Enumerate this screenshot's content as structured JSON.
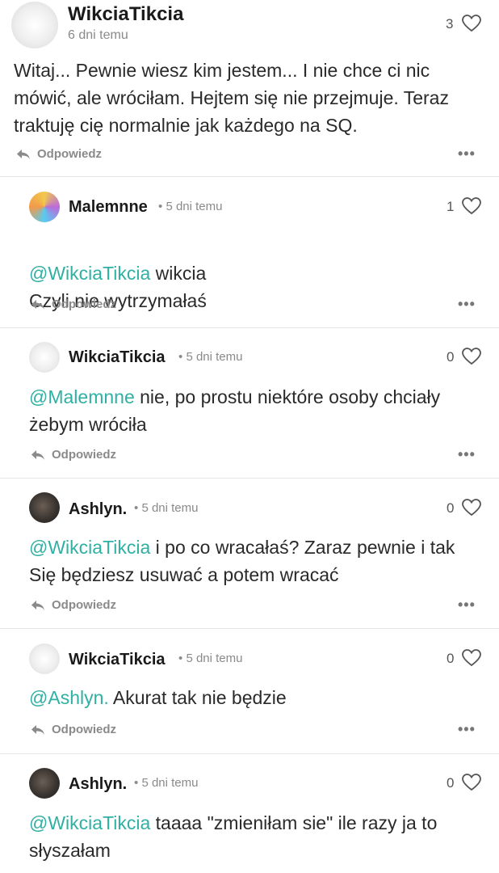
{
  "comments": [
    {
      "author": "WikciaTikcia",
      "time": "6 dni temu",
      "likes": "3",
      "mention": "",
      "text": "Witaj... Pewnie wiesz kim jestem... I nie chce ci nic mówić, ale wróciłam. Hejtem się nie przejmuje. Teraz traktuję cię normalnie jak każdego na SQ.",
      "reply": "Odpowiedz"
    },
    {
      "author": "Malemnne",
      "time": "5 dni temu",
      "likes": "1",
      "mention": "@WikciaTikcia",
      "text": " wikcia\nCzyli nie wytrzymałaś",
      "reply": "Odpowiedz"
    },
    {
      "author": "WikciaTikcia",
      "time": "5 dni temu",
      "likes": "0",
      "mention": "@Malemnne",
      "text": " nie, po prostu niektóre osoby chciały żebym wróciła",
      "reply": "Odpowiedz"
    },
    {
      "author": "Ashlyn.",
      "time": "5 dni temu",
      "likes": "0",
      "mention": "@WikciaTikcia",
      "text": " i po co wracałaś? Zaraz pewnie i tak Się będziesz usuwać a potem wracać",
      "reply": "Odpowiedz"
    },
    {
      "author": "WikciaTikcia",
      "time": "5 dni temu",
      "likes": "0",
      "mention": "@Ashlyn.",
      "text": " Akurat tak nie będzie",
      "reply": "Odpowiedz"
    },
    {
      "author": "Ashlyn.",
      "time": "5 dni temu",
      "likes": "0",
      "mention": "@WikciaTikcia",
      "text": " taaaa \"zmieniłam sie\" ile razy ja to słyszałam",
      "reply": ""
    }
  ],
  "separator": "•",
  "icons": {
    "like": "heart-outline-icon",
    "reply": "reply-arrow-icon",
    "more": "more-dots-icon",
    "avatar": "user-avatar"
  },
  "colors": {
    "mention": "#2fb0a3",
    "meta": "#8a8a8a",
    "divider": "#e6e6e6"
  }
}
